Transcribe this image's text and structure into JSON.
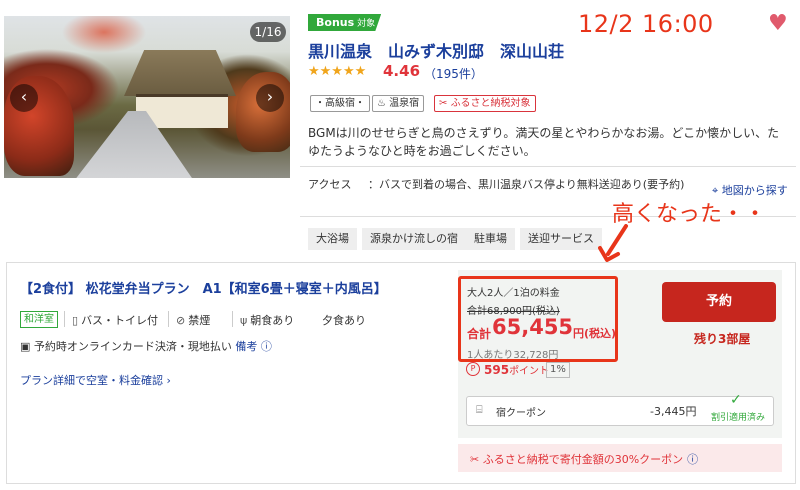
{
  "gallery": {
    "counter": "1/16",
    "prev_icon": "chevron-left-icon",
    "next_icon": "chevron-right-icon"
  },
  "hotel": {
    "bonus_label": "Bonus",
    "bonus_sub": "対象",
    "name": "黒川温泉　山みず木別邸　深山山荘",
    "stars": "★★★★★",
    "rating": "4.46",
    "reviews": "（195件）",
    "tags": [
      "・高級宿・",
      "温泉宿",
      "ふるさと納税対象"
    ],
    "description": "BGMは川のせせらぎと鳥のさえずり。満天の星とやわらかなお湯。どこか懐かしい、たゆたうようなひと時をお過ごしください。",
    "access_label": "アクセス",
    "access_text": "：バスで到着の場合、黒川温泉バス停より無料送迎あり(要予約)",
    "map_link": "地図から探す",
    "amenities": [
      "大浴場",
      "源泉かけ流しの宿",
      "駐車場",
      "送迎サービス"
    ]
  },
  "annotation": {
    "date": "12/2 16:00",
    "note": "高くなった・・",
    "heart_icon": "heart-icon"
  },
  "plan": {
    "title": "【2食付】 松花堂弁当プラン　A1【和室6畳＋寝室＋内風呂】",
    "room_type": "和洋室",
    "features": [
      "バス・トイレ付",
      "禁煙",
      "朝食あり",
      "夕食あり"
    ],
    "payment": "予約時オンラインカード決済・現地払い",
    "payment_note": "備考",
    "detail_link": "プラン詳細で空室・料金確認"
  },
  "price": {
    "persons": "大人2人／1泊の料金",
    "original": "合計68,900円(税込)",
    "total_label": "合計",
    "total": "65,455",
    "total_suffix": "円(税込)",
    "per_person": "1人あたり32,728円",
    "book_label": "予約",
    "rooms_left": "残り3部屋",
    "points": "595",
    "points_unit": "ポイント",
    "points_rate": "1%",
    "coupon_label": "宿クーポン",
    "coupon_amount": "-3,445円",
    "coupon_status": "割引適用済み",
    "furusato": "ふるさと納税で寄付金額の30%クーポン"
  }
}
